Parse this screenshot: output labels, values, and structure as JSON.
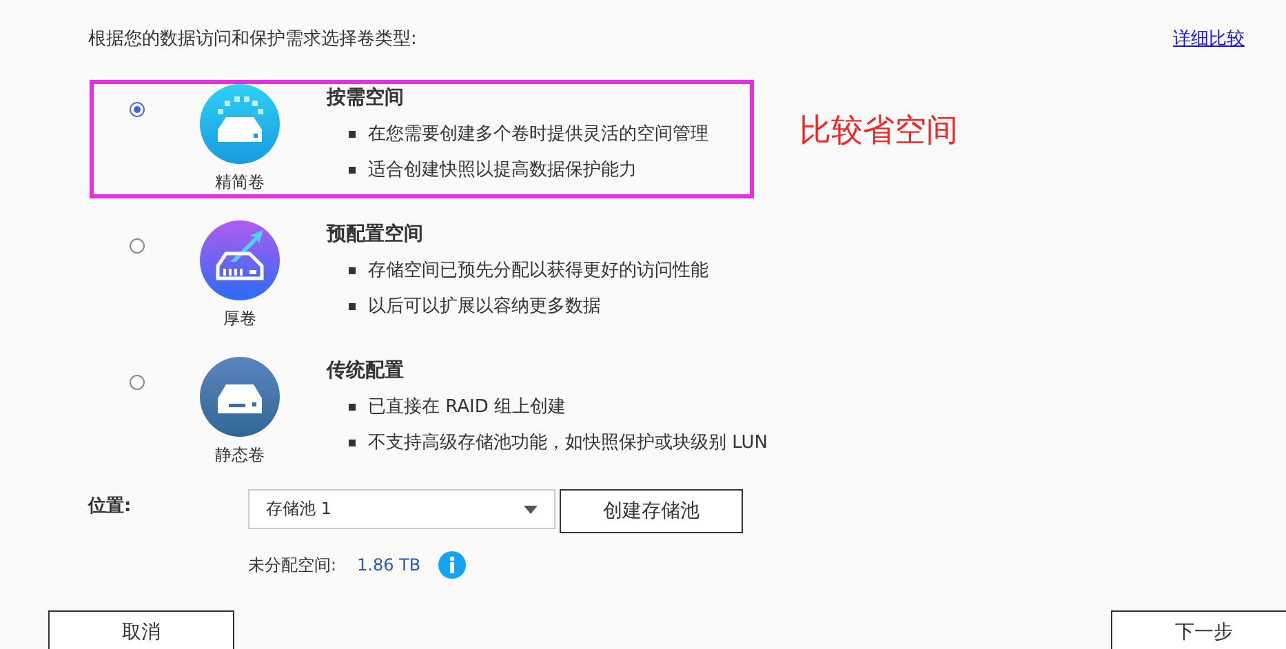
{
  "prompt": "根据您的数据访问和保护需求选择卷类型:",
  "compare_link": "详细比较",
  "options": [
    {
      "kind": "thin",
      "label": "精简卷",
      "title": "按需空间",
      "selected": true,
      "highlighted": true,
      "bullets": [
        "在您需要创建多个卷时提供灵活的空间管理",
        "适合创建快照以提高数据保护能力"
      ]
    },
    {
      "kind": "thick",
      "label": "厚卷",
      "title": "预配置空间",
      "selected": false,
      "highlighted": false,
      "bullets": [
        "存储空间已预先分配以获得更好的访问性能",
        "以后可以扩展以容纳更多数据"
      ]
    },
    {
      "kind": "static",
      "label": "静态卷",
      "title": "传统配置",
      "selected": false,
      "highlighted": false,
      "bullets": [
        "已直接在 RAID 组上创建",
        "不支持高级存储池功能，如快照保护或块级别 LUN"
      ]
    }
  ],
  "annotation": "比较省空间",
  "location": {
    "label": "位置:",
    "pool": "存储池 1",
    "create_button": "创建存储池",
    "unallocated_label": "未分配空间:",
    "unallocated_value": "1.86 TB"
  },
  "buttons": {
    "cancel": "取消",
    "next": "下一步"
  }
}
